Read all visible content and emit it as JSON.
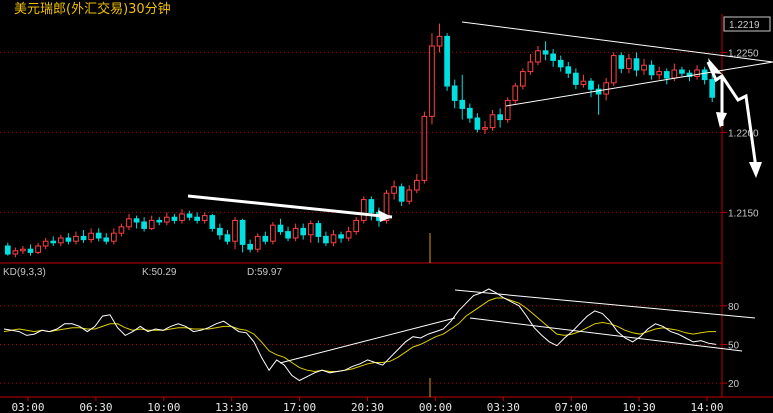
{
  "title": "美元瑞郎(外汇交易)30分钟",
  "price_badge": "1.2219",
  "price_axis": {
    "labels": [
      "1.2250",
      "1.2200",
      "1.2150"
    ],
    "values": [
      1.225,
      1.22,
      1.215
    ],
    "range": [
      1.2119,
      1.2274
    ]
  },
  "kd": {
    "label": "KD(9,3,3)",
    "k_label": "K:50.29",
    "d_label": "D:59.97",
    "axis_labels": [
      "80",
      "50",
      "20"
    ],
    "axis_values": [
      80,
      50,
      20
    ],
    "range": [
      10,
      100
    ]
  },
  "time_labels": [
    "03:00",
    "06:30",
    "10:00",
    "13:30",
    "17:00",
    "20:30",
    "00:00",
    "03:30",
    "07:00",
    "10:30",
    "14:00"
  ],
  "colors": {
    "up": "#ff4040",
    "down": "#00e0e0",
    "grid": "#b00000",
    "axis": "#c00000",
    "k": "#ffffff",
    "d": "#e0d000",
    "text": "#c8c8c8",
    "title": "#f0c000"
  },
  "chart_data": [
    {
      "type": "candlestick",
      "title": "美元瑞郎(外汇交易)30分钟",
      "ylim": [
        1.2119,
        1.2274
      ],
      "y_ticks": [
        1.225,
        1.22,
        1.215
      ],
      "x_ticks": [
        "03:00",
        "06:30",
        "10:00",
        "13:30",
        "17:00",
        "20:30",
        "00:00",
        "03:30",
        "07:00",
        "10:30",
        "14:00"
      ],
      "last": 1.2219,
      "bars": [
        [
          1.2129,
          1.2124,
          1.2131,
          1.2123
        ],
        [
          1.2124,
          1.2126,
          1.2128,
          1.2122
        ],
        [
          1.2126,
          1.2127,
          1.2129,
          1.2124
        ],
        [
          1.2127,
          1.2125,
          1.213,
          1.2123
        ],
        [
          1.2125,
          1.2129,
          1.2131,
          1.2124
        ],
        [
          1.2129,
          1.2132,
          1.2134,
          1.2127
        ],
        [
          1.2132,
          1.2131,
          1.2135,
          1.2129
        ],
        [
          1.2131,
          1.2134,
          1.2136,
          1.2129
        ],
        [
          1.2134,
          1.2132,
          1.2137,
          1.213
        ],
        [
          1.2132,
          1.2135,
          1.2138,
          1.213
        ],
        [
          1.2135,
          1.2133,
          1.2139,
          1.2131
        ],
        [
          1.2133,
          1.2137,
          1.214,
          1.2131
        ],
        [
          1.2137,
          1.2134,
          1.214,
          1.2132
        ],
        [
          1.2134,
          1.2132,
          1.2137,
          1.213
        ],
        [
          1.2132,
          1.2137,
          1.214,
          1.213
        ],
        [
          1.2137,
          1.2141,
          1.2143,
          1.2135
        ],
        [
          1.2141,
          1.2146,
          1.2149,
          1.2139
        ],
        [
          1.2146,
          1.2144,
          1.2148,
          1.214
        ],
        [
          1.2144,
          1.214,
          1.2147,
          1.2138
        ],
        [
          1.214,
          1.2145,
          1.2148,
          1.2139
        ],
        [
          1.2145,
          1.2144,
          1.2147,
          1.2142
        ],
        [
          1.2144,
          1.2147,
          1.215,
          1.2142
        ],
        [
          1.2147,
          1.2145,
          1.2149,
          1.2143
        ],
        [
          1.2145,
          1.2149,
          1.2152,
          1.2143
        ],
        [
          1.2149,
          1.2147,
          1.2151,
          1.2145
        ],
        [
          1.2147,
          1.2145,
          1.215,
          1.2143
        ],
        [
          1.2145,
          1.2148,
          1.215,
          1.2143
        ],
        [
          1.2148,
          1.214,
          1.2149,
          1.2138
        ],
        [
          1.214,
          1.2136,
          1.2143,
          1.2133
        ],
        [
          1.2136,
          1.2132,
          1.2139,
          1.213
        ],
        [
          1.2132,
          1.2145,
          1.2147,
          1.2127
        ],
        [
          1.2145,
          1.213,
          1.2146,
          1.2125
        ],
        [
          1.213,
          1.2127,
          1.2133,
          1.2125
        ],
        [
          1.2127,
          1.2135,
          1.2137,
          1.2125
        ],
        [
          1.2135,
          1.2132,
          1.2138,
          1.213
        ],
        [
          1.2132,
          1.2142,
          1.2144,
          1.213
        ],
        [
          1.2142,
          1.2138,
          1.2146,
          1.2136
        ],
        [
          1.2138,
          1.2134,
          1.2141,
          1.2132
        ],
        [
          1.2134,
          1.214,
          1.2143,
          1.2132
        ],
        [
          1.214,
          1.2136,
          1.2143,
          1.2133
        ],
        [
          1.2136,
          1.2143,
          1.2145,
          1.2131
        ],
        [
          1.2143,
          1.2135,
          1.2145,
          1.2131
        ],
        [
          1.2135,
          1.2131,
          1.2138,
          1.2129
        ],
        [
          1.2131,
          1.2136,
          1.2139,
          1.2129
        ],
        [
          1.2136,
          1.2134,
          1.2138,
          1.2131
        ],
        [
          1.2134,
          1.2138,
          1.2141,
          1.2132
        ],
        [
          1.2138,
          1.2145,
          1.2147,
          1.2136
        ],
        [
          1.2145,
          1.2158,
          1.216,
          1.2143
        ],
        [
          1.2158,
          1.215,
          1.216,
          1.2145
        ],
        [
          1.215,
          1.2145,
          1.2153,
          1.2141
        ],
        [
          1.2145,
          1.2162,
          1.2164,
          1.2143
        ],
        [
          1.2162,
          1.2166,
          1.217,
          1.2158
        ],
        [
          1.2166,
          1.2157,
          1.2168,
          1.2154
        ],
        [
          1.2157,
          1.2164,
          1.2167,
          1.2155
        ],
        [
          1.2164,
          1.217,
          1.2174,
          1.2162
        ],
        [
          1.217,
          1.221,
          1.2213,
          1.2168
        ],
        [
          1.221,
          1.2254,
          1.2262,
          1.2205
        ],
        [
          1.2254,
          1.226,
          1.2268,
          1.225
        ],
        [
          1.226,
          1.2229,
          1.2262,
          1.2226
        ],
        [
          1.2229,
          1.222,
          1.2233,
          1.2215
        ],
        [
          1.222,
          1.2215,
          1.2236,
          1.2208
        ],
        [
          1.2215,
          1.2209,
          1.2218,
          1.2206
        ],
        [
          1.2209,
          1.2202,
          1.2212,
          1.22
        ],
        [
          1.2202,
          1.2203,
          1.2207,
          1.2199
        ],
        [
          1.2203,
          1.2211,
          1.2214,
          1.2201
        ],
        [
          1.2211,
          1.2208,
          1.2215,
          1.2203
        ],
        [
          1.2208,
          1.222,
          1.2222,
          1.2206
        ],
        [
          1.222,
          1.2229,
          1.2231,
          1.2218
        ],
        [
          1.2229,
          1.2238,
          1.224,
          1.2227
        ],
        [
          1.2238,
          1.2244,
          1.2249,
          1.2236
        ],
        [
          1.2244,
          1.2251,
          1.2254,
          1.2242
        ],
        [
          1.2251,
          1.2249,
          1.2257,
          1.2245
        ],
        [
          1.2249,
          1.2245,
          1.2252,
          1.2241
        ],
        [
          1.2245,
          1.2241,
          1.2248,
          1.2238
        ],
        [
          1.2241,
          1.2237,
          1.2244,
          1.2234
        ],
        [
          1.2237,
          1.223,
          1.224,
          1.2227
        ],
        [
          1.223,
          1.2232,
          1.2236,
          1.2228
        ],
        [
          1.2232,
          1.2227,
          1.2234,
          1.2222
        ],
        [
          1.2227,
          1.2224,
          1.223,
          1.2211
        ],
        [
          1.2224,
          1.2231,
          1.2234,
          1.222
        ],
        [
          1.2231,
          1.2248,
          1.225,
          1.2229
        ],
        [
          1.2248,
          1.224,
          1.225,
          1.2237
        ],
        [
          1.224,
          1.2246,
          1.2249,
          1.2237
        ],
        [
          1.2246,
          1.2239,
          1.225,
          1.2235
        ],
        [
          1.2239,
          1.2242,
          1.2246,
          1.2236
        ],
        [
          1.2242,
          1.2236,
          1.2245,
          1.2233
        ],
        [
          1.2236,
          1.2238,
          1.2241,
          1.2233
        ],
        [
          1.2238,
          1.2234,
          1.224,
          1.223
        ],
        [
          1.2234,
          1.2239,
          1.2243,
          1.2232
        ],
        [
          1.2239,
          1.2237,
          1.2241,
          1.2235
        ],
        [
          1.2237,
          1.2235,
          1.2239,
          1.2232
        ],
        [
          1.2235,
          1.2239,
          1.2242,
          1.2233
        ],
        [
          1.2239,
          1.2233,
          1.2241,
          1.223
        ],
        [
          1.2233,
          1.2222,
          1.2236,
          1.2219
        ]
      ]
    },
    {
      "type": "line",
      "title": "KD(9,3,3)",
      "ylim": [
        10,
        100
      ],
      "y_ticks": [
        80,
        50,
        20
      ],
      "series": [
        {
          "name": "K",
          "values": [
            62,
            61,
            60,
            57,
            58,
            61,
            60,
            62,
            66,
            66,
            64,
            60,
            64,
            72,
            73,
            63,
            57,
            60,
            64,
            60,
            62,
            61,
            64,
            66,
            64,
            60,
            61,
            63,
            66,
            68,
            64,
            60,
            59,
            52,
            40,
            30,
            38,
            34,
            26,
            22,
            25,
            28,
            30,
            28,
            29,
            30,
            33,
            35,
            38,
            36,
            34,
            40,
            46,
            52,
            56,
            55,
            58,
            60,
            62,
            68,
            76,
            82,
            88,
            90,
            93,
            90,
            86,
            83,
            80,
            72,
            63,
            57,
            52,
            49,
            55,
            60,
            66,
            72,
            76,
            74,
            68,
            60,
            55,
            52,
            56,
            62,
            66,
            64,
            60,
            58,
            55,
            52,
            53,
            51,
            50
          ]
        },
        {
          "name": "D",
          "values": [
            60,
            61,
            62,
            61,
            60,
            61,
            60,
            61,
            62,
            63,
            63,
            62,
            62,
            64,
            66,
            66,
            63,
            61,
            62,
            61,
            61,
            61,
            62,
            63,
            63,
            62,
            62,
            62,
            63,
            64,
            64,
            62,
            61,
            58,
            52,
            45,
            42,
            40,
            36,
            32,
            30,
            29,
            30,
            29,
            29,
            30,
            31,
            33,
            35,
            36,
            36,
            37,
            40,
            44,
            48,
            50,
            53,
            56,
            58,
            62,
            66,
            72,
            76,
            80,
            84,
            86,
            86,
            84,
            82,
            78,
            73,
            68,
            63,
            58,
            57,
            58,
            60,
            63,
            66,
            67,
            66,
            64,
            61,
            59,
            58,
            60,
            62,
            63,
            62,
            61,
            59,
            58,
            59,
            60,
            59.97
          ]
        }
      ]
    }
  ]
}
